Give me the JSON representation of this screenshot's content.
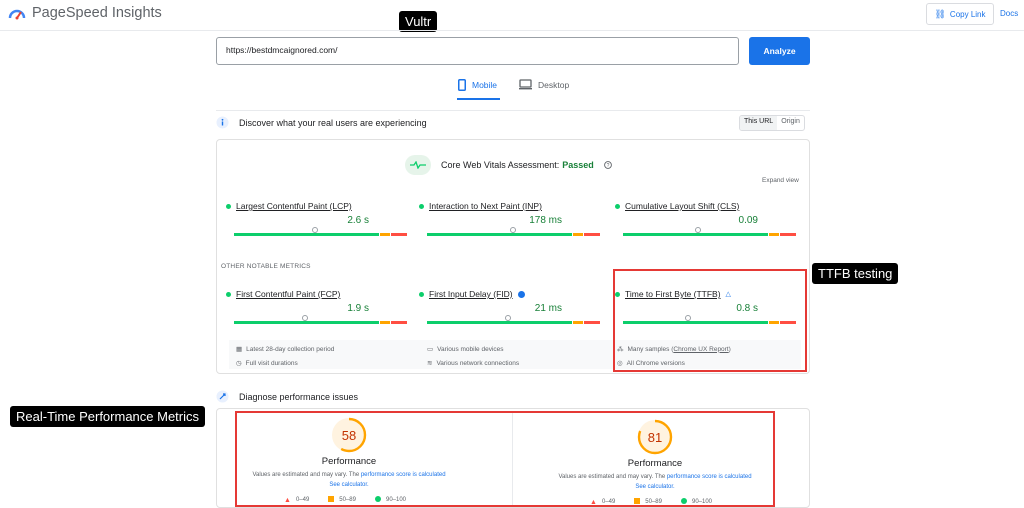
{
  "app": {
    "title": "PageSpeed Insights",
    "copy_link": "Copy Link",
    "docs": "Docs"
  },
  "annotations": {
    "vultr": "Vultr",
    "ttfb": "TTFB testing",
    "realtime": "Real-Time Performance Metrics"
  },
  "url": {
    "value": "https://bestdmcaignored.com/",
    "analyze": "Analyze"
  },
  "tabs": [
    {
      "label": "Mobile",
      "active": true
    },
    {
      "label": "Desktop",
      "active": false
    }
  ],
  "section1": {
    "title": "Discover what your real users are experiencing",
    "toggle": [
      "This URL",
      "Origin"
    ]
  },
  "cwv": {
    "label": "Core Web Vitals Assessment:",
    "status": "Passed",
    "expand": "Expand view"
  },
  "core_metrics": [
    {
      "name": "Largest Contentful Paint (LCP)",
      "value": "2.6 s",
      "marker": 0.78
    },
    {
      "name": "Interaction to Next Paint (INP)",
      "value": "178 ms",
      "marker": 0.83
    },
    {
      "name": "Cumulative Layout Shift (CLS)",
      "value": "0.09",
      "marker": 0.72
    }
  ],
  "other_heading": "OTHER NOTABLE METRICS",
  "other_metrics": [
    {
      "name": "First Contentful Paint (FCP)",
      "value": "1.9 s",
      "marker": 0.68
    },
    {
      "name": "First Input Delay (FID)",
      "value": "21 ms",
      "marker": 0.78
    },
    {
      "name": "Time to First Byte (TTFB)",
      "value": "0.8 s",
      "marker": 0.62
    }
  ],
  "footer": {
    "col1": [
      "Latest 28-day collection period",
      "Full visit durations"
    ],
    "col2": [
      "Various mobile devices",
      "Various network connections"
    ],
    "col3_a_pre": "Many samples (",
    "col3_a_link": "Chrome UX Report",
    "col3_a_post": ")",
    "col3_b": "All Chrome versions"
  },
  "section2": {
    "title": "Diagnose performance issues"
  },
  "scores": [
    {
      "value": "58",
      "label": "Performance",
      "score": 58
    },
    {
      "value": "81",
      "label": "Performance",
      "score": 81
    }
  ],
  "score_note": {
    "pre": "Values are estimated and may vary. The ",
    "link": "performance score is calculated",
    "calc": "See calculator."
  },
  "legend": [
    "0–49",
    "50–89",
    "90–100"
  ],
  "colors": {
    "accent": "#1a73e8",
    "good": "#0cce6b",
    "average": "#ffa400",
    "poor": "#ff4e42",
    "annotation": "#e53935"
  }
}
